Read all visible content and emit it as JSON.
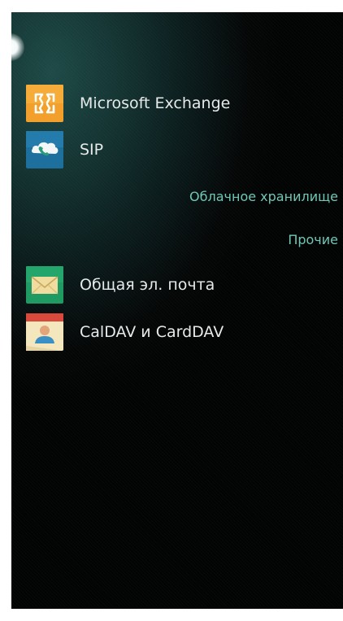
{
  "accounts_top": [
    {
      "label": "Microsoft Exchange",
      "icon": "exchange-icon"
    },
    {
      "label": "SIP",
      "icon": "sip-phone-cloud-icon"
    }
  ],
  "sections": {
    "cloud_storage": "Облачное хранилище",
    "other": "Прочие"
  },
  "accounts_other": [
    {
      "label": "Общая эл. почта",
      "icon": "envelope-icon"
    },
    {
      "label": "CalDAV и CardDAV",
      "icon": "calendar-contact-icon"
    }
  ],
  "colors": {
    "section_header": "#6fc7b5",
    "exchange_orange": "#f2a02b",
    "sip_blue": "#1d6f9e",
    "mail_green": "#1f9a63"
  }
}
